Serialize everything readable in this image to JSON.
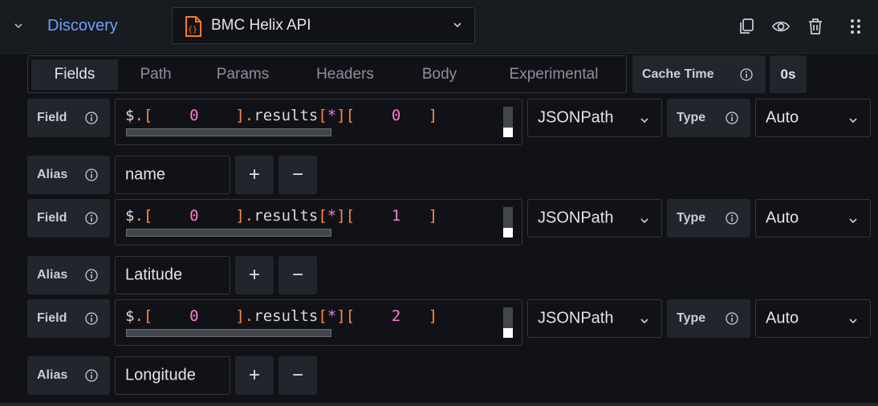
{
  "query": {
    "name": "Discovery"
  },
  "datasource": {
    "name": "BMC Helix API"
  },
  "tabs": [
    "Fields",
    "Path",
    "Params",
    "Headers",
    "Body",
    "Experimental"
  ],
  "active_tab": "Fields",
  "cache": {
    "label": "Cache Time",
    "value": "0s"
  },
  "labels": {
    "field": "Field",
    "alias": "Alias",
    "type": "Type"
  },
  "fields": [
    {
      "code_prefix": "$",
      "code_dot1": ".",
      "code_lb1": "[",
      "index1": "0",
      "code_rb1": "]",
      "code_dot2": ".",
      "code_key": "results",
      "code_lb2": "[",
      "code_star": "*",
      "code_rb2": "]",
      "code_lb3": "[",
      "index2": "0",
      "code_rb3": "]",
      "mode": "JSONPath",
      "type": "Auto",
      "alias": "name"
    },
    {
      "code_prefix": "$",
      "code_dot1": ".",
      "code_lb1": "[",
      "index1": "0",
      "code_rb1": "]",
      "code_dot2": ".",
      "code_key": "results",
      "code_lb2": "[",
      "code_star": "*",
      "code_rb2": "]",
      "code_lb3": "[",
      "index2": "1",
      "code_rb3": "]",
      "mode": "JSONPath",
      "type": "Auto",
      "alias": "Latitude"
    },
    {
      "code_prefix": "$",
      "code_dot1": ".",
      "code_lb1": "[",
      "index1": "0",
      "code_rb1": "]",
      "code_dot2": ".",
      "code_key": "results",
      "code_lb2": "[",
      "code_star": "*",
      "code_rb2": "]",
      "code_lb3": "[",
      "index2": "2",
      "code_rb3": "]",
      "mode": "JSONPath",
      "type": "Auto",
      "alias": "Longitude"
    }
  ],
  "buttons": {
    "add": "+",
    "remove": "−"
  },
  "colors": {
    "accent": "#6e9fff",
    "json_orange": "#ff8a3d",
    "json_number": "#ff7ad6",
    "background": "#111217",
    "panel": "#22252b"
  },
  "icons": {
    "collapse": "chevron-down-icon",
    "datasource": "json-braces-icon",
    "duplicate": "copy-icon",
    "toggle_visibility": "eye-icon",
    "delete": "trash-icon",
    "drag": "drag-handle-icon",
    "info": "info-icon"
  }
}
